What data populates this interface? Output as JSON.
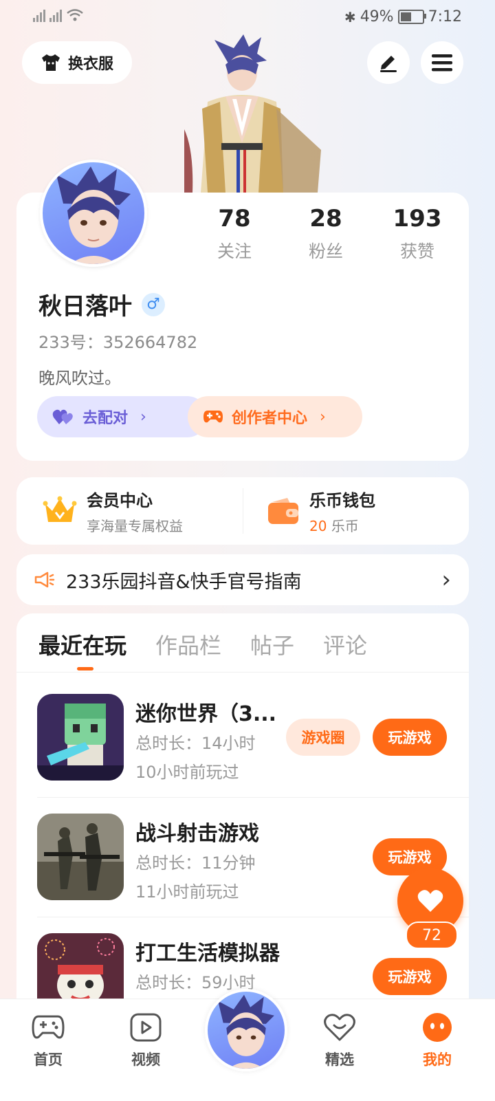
{
  "status_bar": {
    "battery": "49%",
    "time": "7:12"
  },
  "top": {
    "outfit_label": "换衣服"
  },
  "profile": {
    "stats": [
      {
        "value": "78",
        "label": "关注"
      },
      {
        "value": "28",
        "label": "粉丝"
      },
      {
        "value": "193",
        "label": "获赞"
      }
    ],
    "nickname": "秋日落叶",
    "gender_symbol": "♂",
    "uid_text": "233号：352664782",
    "bio": "晚风吹过。",
    "pair_button": "去配对",
    "creator_button": "创作者中心"
  },
  "member": {
    "title": "会员中心",
    "subtitle": "享海量专属权益"
  },
  "wallet": {
    "title": "乐币钱包",
    "amount": "20",
    "unit": "乐币"
  },
  "notice": {
    "text": "233乐园抖音&快手官号指南"
  },
  "tabs": [
    "最近在玩",
    "作品栏",
    "帖子",
    "评论"
  ],
  "games": [
    {
      "name": "迷你世界（3...",
      "duration": "总时长：14小时",
      "last_played": "10小时前玩过",
      "circle_button": "游戏圈",
      "play_button": "玩游戏"
    },
    {
      "name": "战斗射击游戏",
      "duration": "总时长：11分钟",
      "last_played": "11小时前玩过",
      "play_button": "玩游戏"
    },
    {
      "name": "打工生活模拟器",
      "duration": "总时长：59小时",
      "play_button": "玩游戏"
    }
  ],
  "floating_like": {
    "count": "72"
  },
  "bottom_nav": [
    {
      "label": "首页"
    },
    {
      "label": "视频"
    },
    {
      "label": "精选"
    },
    {
      "label": "我的"
    }
  ],
  "colors": {
    "accent": "#ff6a16",
    "pair": "#6a5ed6",
    "gold": "#ffb21c"
  }
}
